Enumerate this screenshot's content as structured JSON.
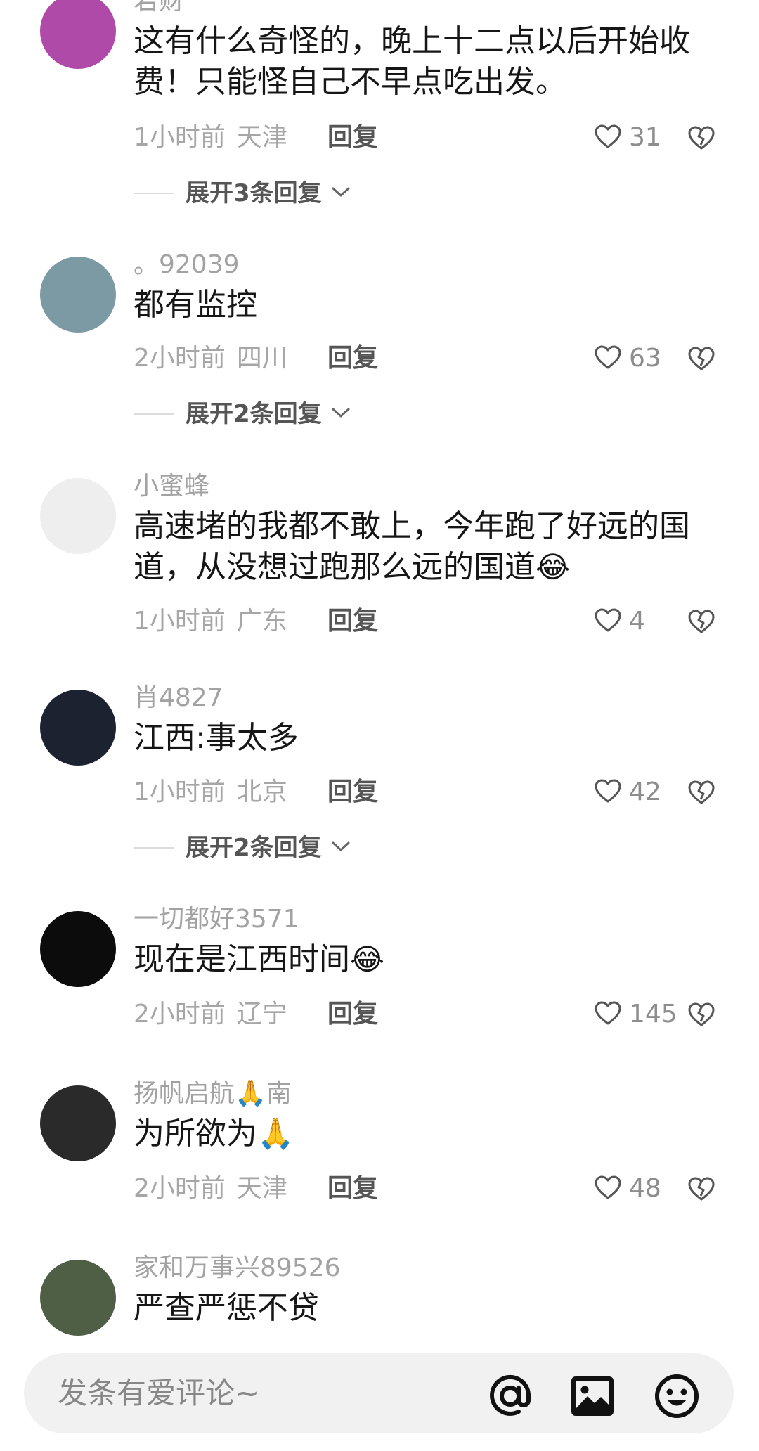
{
  "comments": [
    {
      "username": "若财",
      "text": "这有什么奇怪的，晚上十二点以后开始收费！只能怪自己不早点吃出发。",
      "emoji": "",
      "time": "1小时前",
      "location": "天津",
      "reply_label": "回复",
      "likes": "31",
      "expand_label": "展开3条回复",
      "avatar_color": "#b04aa8"
    },
    {
      "username": "。92039",
      "text": "都有监控",
      "emoji": "",
      "time": "2小时前",
      "location": "四川",
      "reply_label": "回复",
      "likes": "63",
      "expand_label": "展开2条回复",
      "avatar_color": "#7b9aa3"
    },
    {
      "username": "小蜜蜂",
      "text": "高速堵的我都不敢上，今年跑了好远的国道，从没想过跑那么远的国道",
      "emoji": "😂",
      "time": "1小时前",
      "location": "广东",
      "reply_label": "回复",
      "likes": "4",
      "expand_label": "",
      "avatar_color": "#eeeeee"
    },
    {
      "username": "肖4827",
      "text": "江西:事太多",
      "emoji": "",
      "time": "1小时前",
      "location": "北京",
      "reply_label": "回复",
      "likes": "42",
      "expand_label": "展开2条回复",
      "avatar_color": "#1d2230"
    },
    {
      "username": "一切都好3571",
      "text": "现在是江西时间",
      "emoji": "😂",
      "time": "2小时前",
      "location": "辽宁",
      "reply_label": "回复",
      "likes": "145",
      "expand_label": "",
      "avatar_color": "#0c0c0c"
    },
    {
      "username": "扬帆启航🙏南",
      "text": "为所欲为",
      "emoji": "🙏",
      "time": "2小时前",
      "location": "天津",
      "reply_label": "回复",
      "likes": "48",
      "expand_label": "",
      "avatar_color": "#2a2a2a"
    },
    {
      "username": "家和万事兴89526",
      "text": "严查严惩不贷",
      "emoji": "",
      "time": "",
      "location": "",
      "reply_label": "",
      "likes": "",
      "expand_label": "",
      "avatar_color": "#4f5f45"
    }
  ],
  "bottom_bar": {
    "input_placeholder": "发条有爱评论~",
    "icons": [
      "at-icon",
      "image-icon",
      "emoji-icon"
    ]
  },
  "colors": {
    "text_primary": "#161616",
    "text_secondary": "#a2a2a2",
    "action_text": "#555555"
  }
}
